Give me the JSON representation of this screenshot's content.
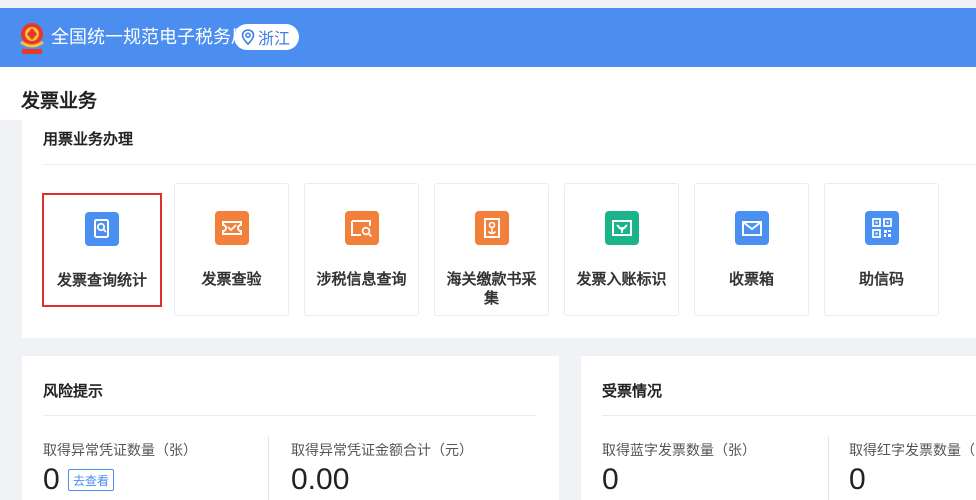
{
  "header": {
    "site_title": "全国统一规范电子税务局",
    "region": "浙江",
    "emblem_text": "中国税务"
  },
  "page": {
    "title": "发票业务"
  },
  "service_section": {
    "title": "用票业务办理",
    "tiles": [
      {
        "label": "发票查询统计",
        "icon": "search-doc-icon",
        "color": "#4a8ff2",
        "selected": true
      },
      {
        "label": "发票查验",
        "icon": "ticket-verify-icon",
        "color": "#f2803a",
        "selected": false
      },
      {
        "label": "涉税信息查询",
        "icon": "info-search-icon",
        "color": "#f2803a",
        "selected": false
      },
      {
        "label": "海关缴款书采集",
        "icon": "customs-collect-icon",
        "color": "#f2803a",
        "selected": false
      },
      {
        "label": "发票入账标识",
        "icon": "invoice-mark-icon",
        "color": "#1bb389",
        "selected": false
      },
      {
        "label": "收票箱",
        "icon": "mailbox-icon",
        "color": "#4a8ff2",
        "selected": false
      },
      {
        "label": "助信码",
        "icon": "qr-code-icon",
        "color": "#4a8ff2",
        "selected": false
      }
    ]
  },
  "risk": {
    "title": "风险提示",
    "abnormal_count_label": "取得异常凭证数量（张）",
    "abnormal_count_value": "0",
    "view_button": "去查看",
    "abnormal_amount_label": "取得异常凭证金额合计（元）",
    "abnormal_amount_value": "0.00"
  },
  "receipt": {
    "title": "受票情况",
    "blue_count_label": "取得蓝字发票数量（张）",
    "blue_count_value": "0",
    "red_count_label": "取得红字发票数量（张）",
    "red_count_value": "0"
  }
}
